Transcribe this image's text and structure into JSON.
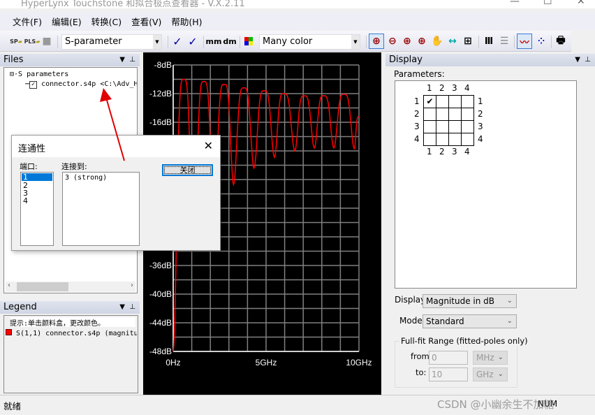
{
  "window": {
    "title": "HyperLynx Touchstone 和拟合极点查看器 - V.X.2.11"
  },
  "menu": [
    "文件(F)",
    "编辑(E)",
    "转换(C)",
    "查看(V)",
    "帮助(H)"
  ],
  "toolbar": {
    "open_sp": "SP",
    "open_pls": "PLS",
    "param_type": "S-parameter",
    "mm": "mm",
    "dm": "dm",
    "color_mode": "Many color"
  },
  "files": {
    "title": "Files",
    "root": "S parameters",
    "file": "connector.s4p <C:\\Adv_H"
  },
  "legend": {
    "title": "Legend",
    "hint": "提示:单击颜料盒，更改颜色。",
    "entry": "S(1,1) connector.s4p (magnitud",
    "entry_color": "#ff0000"
  },
  "dialog": {
    "title": "连通性",
    "ports_label": "端口:",
    "ports": [
      "1",
      "2",
      "3",
      "4"
    ],
    "selected_port": "1",
    "connected_label": "连接到:",
    "connected": [
      "3 (strong)"
    ],
    "close": "关闭"
  },
  "display": {
    "title": "Display",
    "parameters_label": "Parameters:",
    "ports": [
      "1",
      "2",
      "3",
      "4"
    ],
    "checked": [
      [
        1,
        1
      ]
    ],
    "display_label": "Display:",
    "display_value": "Magnitude in dB",
    "mode_label": "Mode:",
    "mode_value": "Standard",
    "range_title": "Full-fit Range (fitted-poles only)",
    "from_label": "from:",
    "from_value": "0",
    "from_unit": "MHz",
    "to_label": "to:",
    "to_value": "10",
    "to_unit": "GHz"
  },
  "status": {
    "text": "就绪",
    "indicator": "NUM",
    "watermark": "CSDN @小幽余生不加糖"
  },
  "chart_data": {
    "type": "line",
    "xlim": [
      0,
      10
    ],
    "ylim": [
      -48,
      -8
    ],
    "grid": true,
    "x_ticks": [
      "0Hz",
      "5GHz",
      "10GHz"
    ],
    "y_ticks": [
      {
        "v": -8,
        "label": "-8dB"
      },
      {
        "v": -12,
        "label": "-12dB"
      },
      {
        "v": -16,
        "label": "-16dB"
      },
      {
        "v": -36,
        "label": "-36dB"
      },
      {
        "v": -40,
        "label": "-40dB"
      },
      {
        "v": -44,
        "label": "-44dB"
      },
      {
        "v": -48,
        "label": "-48dB"
      }
    ],
    "series": [
      {
        "color": "#ff0000",
        "x_unit": "GHz",
        "y_unit": "dB",
        "points": [
          [
            0,
            -48
          ],
          [
            0.57,
            -10
          ],
          [
            1.1,
            -34
          ],
          [
            1.65,
            -10.3
          ],
          [
            2.2,
            -28
          ],
          [
            2.75,
            -10.7
          ],
          [
            3.25,
            -24.7
          ],
          [
            3.8,
            -11.2
          ],
          [
            4.35,
            -22.4
          ],
          [
            4.9,
            -11.6
          ],
          [
            5.45,
            -20.9
          ],
          [
            5.95,
            -12
          ],
          [
            6.55,
            -20
          ],
          [
            7.05,
            -12.3
          ],
          [
            7.6,
            -19.6
          ],
          [
            8.1,
            -12.3
          ],
          [
            8.65,
            -19.6
          ],
          [
            9.2,
            -12.1
          ],
          [
            9.75,
            -19.7
          ],
          [
            10,
            -15.2
          ]
        ]
      }
    ]
  }
}
